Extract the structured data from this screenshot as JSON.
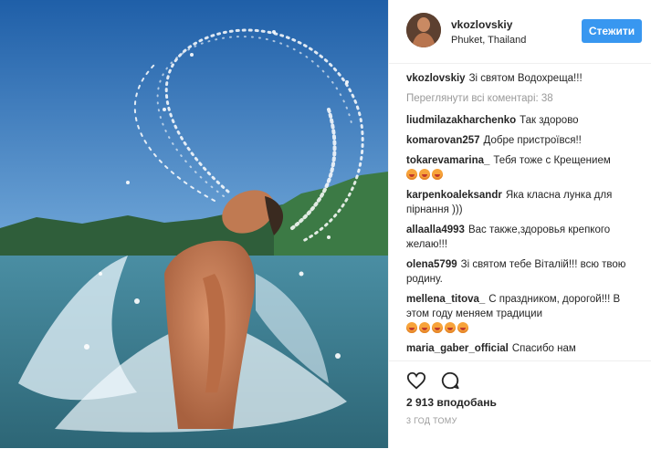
{
  "post": {
    "username": "vkozlovskiy",
    "location": "Phuket, Thailand",
    "follow_label": "Стежити",
    "caption": {
      "user": "vkozlovskiy",
      "text": "Зі святом Водохреща!!!"
    },
    "view_all": "Переглянути всі коментарі: 38",
    "comments": [
      {
        "user": "liudmilazakharchenko",
        "text": "Так здорово",
        "emoji": 0
      },
      {
        "user": "komarovan257",
        "text": "Добре пристроївся!!",
        "emoji": 0
      },
      {
        "user": "tokarevamarina_",
        "text": "Тебя тоже с Крещением",
        "emoji": 3
      },
      {
        "user": "karpenkoaleksandr",
        "text": "Яка класна лунка для пірнання )))",
        "emoji": 0
      },
      {
        "user": "allaalla4993",
        "text": "Вас также,здоровья крепкого желаю!!!",
        "emoji": 0
      },
      {
        "user": "olena5799",
        "text": "Зі святом тебе Віталій!!! всю твою родину.",
        "emoji": 0
      },
      {
        "user": "mellena_titova_",
        "text": "С праздником, дорогой!!! В этом году меняем традиции",
        "emoji": 5
      },
      {
        "user": "maria_gaber_official",
        "text": "Спасибо нам",
        "emoji": 0
      }
    ],
    "likes": "2 913 вподобань",
    "time": "3 ГОД ТОМУ"
  },
  "icons": {
    "like": "heart-icon",
    "comment": "comment-icon"
  },
  "colors": {
    "accent": "#3897f0",
    "sea": "#3f7f96",
    "sky": "#3d7fc2"
  }
}
